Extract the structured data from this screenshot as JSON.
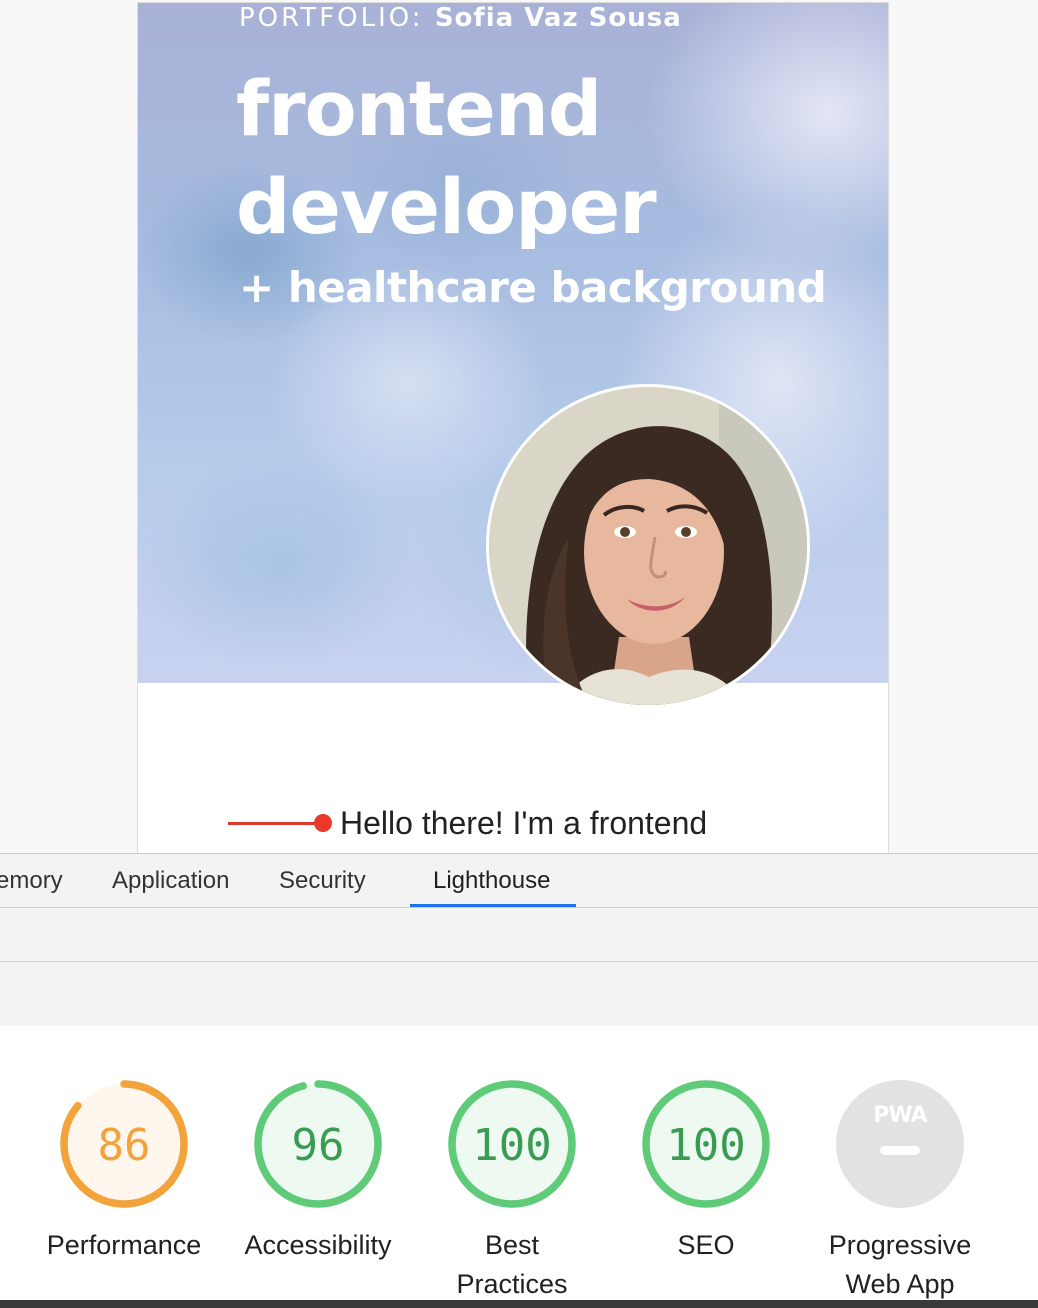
{
  "page": {
    "kicker_prefix": "PORTFOLIO: ",
    "kicker_name": "Sofia Vaz Sousa",
    "title_line1": "frontend",
    "title_line2": "developer",
    "subtitle": "+ healthcare background",
    "intro_text": "Hello there! I'm a frontend"
  },
  "devtools": {
    "tabs": [
      {
        "label": "emory",
        "active": false
      },
      {
        "label": "Application",
        "active": false
      },
      {
        "label": "Security",
        "active": false
      },
      {
        "label": "Lighthouse",
        "active": true
      }
    ],
    "accent_color": "#1a73e8"
  },
  "lighthouse": {
    "categories": [
      {
        "label": "Performance",
        "score": "86",
        "fraction": 0.86,
        "color": "#f2a33c",
        "fill": "#fff7ee",
        "text_color": "#f2a33c"
      },
      {
        "label": "Accessibility",
        "score": "96",
        "fraction": 0.96,
        "color": "#5fcb78",
        "fill": "#eefaf1",
        "text_color": "#3a9b52"
      },
      {
        "label": "Best Practices",
        "score": "100",
        "fraction": 1.0,
        "color": "#5fcb78",
        "fill": "#eefaf1",
        "text_color": "#3a9b52"
      },
      {
        "label": "SEO",
        "score": "100",
        "fraction": 1.0,
        "color": "#5fcb78",
        "fill": "#eefaf1",
        "text_color": "#3a9b52"
      },
      {
        "label": "Progressive Web App",
        "badge": "PWA",
        "color": "#e0e0e0",
        "fill": "#e2e2e2",
        "text_color": "#9e9e9e"
      }
    ]
  }
}
